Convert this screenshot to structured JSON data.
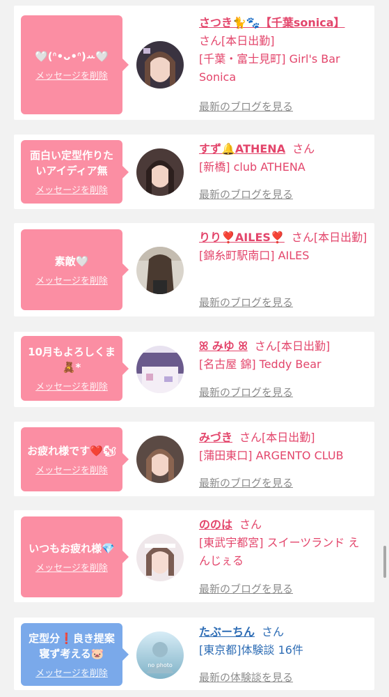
{
  "colors": {
    "page_bg": "#f2f2f2",
    "pink_bubble": "#fb8ea3",
    "blue_bubble": "#7aa9ea",
    "name_pink": "#e3456b",
    "name_blue": "#2e6db5",
    "link_gray": "#8c8c8c"
  },
  "items": [
    {
      "message": "🤍(ᐢ•ᴗ•ᐢ)ꕀ🤍",
      "delete_label": "メッセージを削除",
      "name": "さつき🐈🐾【千葉sonica】",
      "san": "さん",
      "status": "[本日出勤]",
      "location": "[千葉・富士見町] Girl's Bar Sonica",
      "blog_label": "最新のブログを見る",
      "avatar_icon": "avatar-photo"
    },
    {
      "message": "面白い定型作りたいアイディア無",
      "delete_label": "メッセージを削除",
      "name": "すず🔔ATHENA",
      "san": "さん",
      "status": "",
      "location": "[新橋] club ATHENA",
      "blog_label": "最新のブログを見る",
      "avatar_icon": "avatar-photo"
    },
    {
      "message": "素敵🤍",
      "delete_label": "メッセージを削除",
      "name": "りり❣️AILES❣️",
      "san": "さん",
      "status": "[本日出勤]",
      "location": "[錦糸町駅南口] AILES",
      "blog_label": "最新のブログを見る",
      "avatar_icon": "avatar-photo"
    },
    {
      "message": "10月もよろしくま🧸*",
      "delete_label": "メッセージを削除",
      "name": "ꕤ みゆ ꕤ",
      "san": "さん",
      "status": "[本日出勤]",
      "location": "[名古屋 錦] Teddy Bear",
      "blog_label": "最新のブログを見る",
      "avatar_icon": "avatar-photo"
    },
    {
      "message": "お疲れ様です❤️🐿",
      "delete_label": "メッセージを削除",
      "name": "みづき",
      "san": "さん",
      "status": "[本日出勤]",
      "location": "[蒲田東口] ARGENTO CLUB",
      "blog_label": "最新のブログを見る",
      "avatar_icon": "avatar-photo"
    },
    {
      "message": "いつもお疲れ様💎",
      "delete_label": "メッセージを削除",
      "name": "ののは",
      "san": "さん",
      "status": "",
      "location": "[東武宇都宮] スイーツランド えんじぇる",
      "blog_label": "最新のブログを見る",
      "avatar_icon": "avatar-photo"
    },
    {
      "message": "定型分❗️良き提案寝ず考える🐷",
      "delete_label": "メッセージを削除",
      "name": "たぶーちん",
      "san": "さん",
      "status": "",
      "location": "[東京都]体験談 16件",
      "blog_label": "最新の体験談を見る",
      "avatar_icon": "no-photo-avatar",
      "avatar_text": "no photo"
    }
  ]
}
